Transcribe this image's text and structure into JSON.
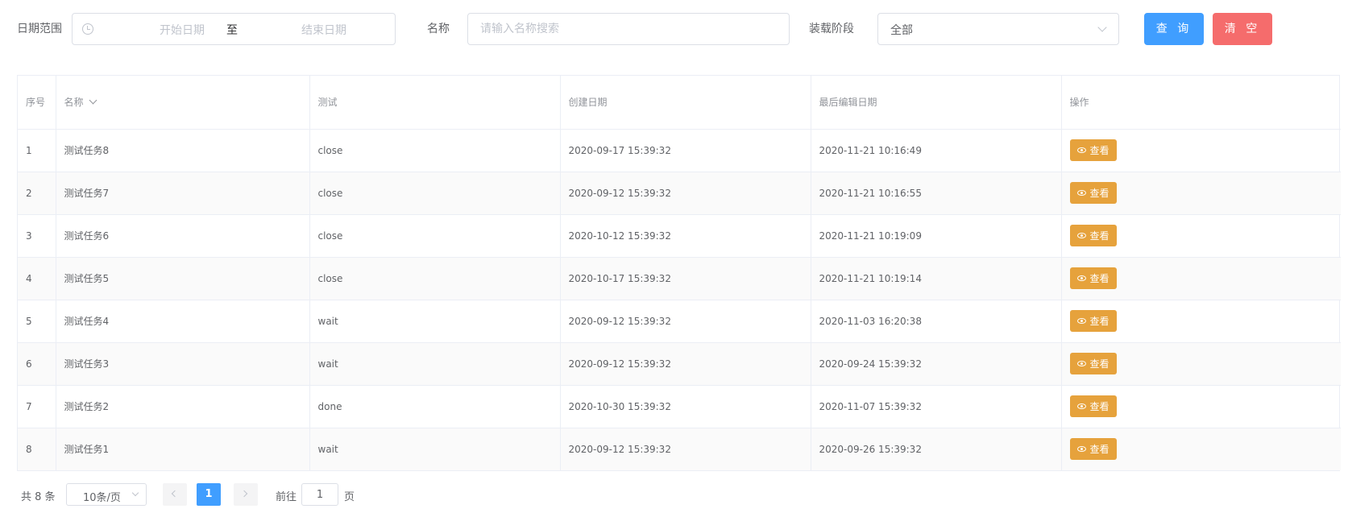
{
  "filters": {
    "date_range_label": "日期范围",
    "start_placeholder": "开始日期",
    "range_separator": "至",
    "end_placeholder": "结束日期",
    "name_label": "名称",
    "name_placeholder": "请输入名称搜索",
    "name_value": "",
    "stage_label": "装载阶段",
    "stage_value": "全部",
    "query_button": "查 询",
    "clear_button": "清 空"
  },
  "table": {
    "columns": [
      "序号",
      "名称",
      "测试",
      "创建日期",
      "最后编辑日期",
      "操作"
    ],
    "rows": [
      {
        "index": "1",
        "name": "测试任务8",
        "test": "close",
        "created": "2020-09-17 15:39:32",
        "edited": "2020-11-21 10:16:49",
        "action": "查看"
      },
      {
        "index": "2",
        "name": "测试任务7",
        "test": "close",
        "created": "2020-09-12 15:39:32",
        "edited": "2020-11-21 10:16:55",
        "action": "查看"
      },
      {
        "index": "3",
        "name": "测试任务6",
        "test": "close",
        "created": "2020-10-12 15:39:32",
        "edited": "2020-11-21 10:19:09",
        "action": "查看"
      },
      {
        "index": "4",
        "name": "测试任务5",
        "test": "close",
        "created": "2020-10-17 15:39:32",
        "edited": "2020-11-21 10:19:14",
        "action": "查看"
      },
      {
        "index": "5",
        "name": "测试任务4",
        "test": "wait",
        "created": "2020-09-12 15:39:32",
        "edited": "2020-11-03 16:20:38",
        "action": "查看"
      },
      {
        "index": "6",
        "name": "测试任务3",
        "test": "wait",
        "created": "2020-09-12 15:39:32",
        "edited": "2020-09-24 15:39:32",
        "action": "查看"
      },
      {
        "index": "7",
        "name": "测试任务2",
        "test": "done",
        "created": "2020-10-30 15:39:32",
        "edited": "2020-11-07 15:39:32",
        "action": "查看"
      },
      {
        "index": "8",
        "name": "测试任务1",
        "test": "wait",
        "created": "2020-09-12 15:39:32",
        "edited": "2020-09-26 15:39:32",
        "action": "查看"
      }
    ]
  },
  "pagination": {
    "total": "共 8 条",
    "page_size": "10条/页",
    "current_page": "1",
    "goto_label": "前往",
    "goto_value": "1",
    "page_unit": "页"
  },
  "colors": {
    "primary": "#409eff",
    "danger": "#f56c6c",
    "warning": "#e6a23c"
  },
  "icons": {
    "date": "clock-icon",
    "select": "chevron-down-icon",
    "sort": "chevron-down-icon",
    "view": "eye-icon",
    "prev": "chevron-left-icon",
    "next": "chevron-right-icon"
  }
}
